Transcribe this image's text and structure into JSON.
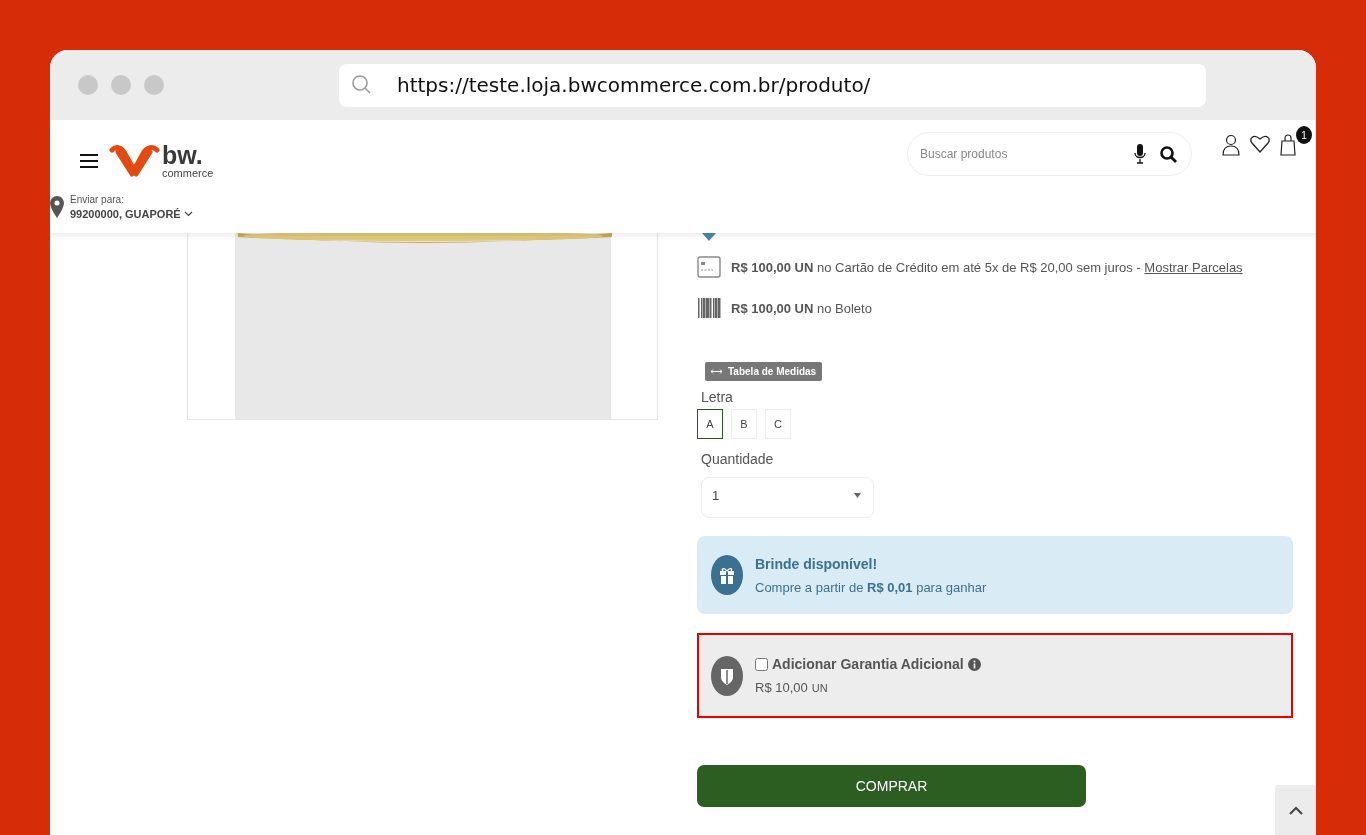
{
  "browser": {
    "url": "https://teste.loja.bwcommerce.com.br/produto/"
  },
  "header": {
    "logo": {
      "name": "bw.",
      "tagline": "commerce"
    },
    "search": {
      "placeholder": "Buscar produtos"
    },
    "cart_count": "1",
    "shipping": {
      "label": "Enviar para:",
      "location": "99200000, GUAPORÉ"
    }
  },
  "payments": [
    {
      "kind": "card",
      "text": "**R$ 100,00 UN** no Cartão de Crédito em até 5x de R$ 20,00 sem juros -",
      "link": "Mostrar Parcelas"
    },
    {
      "kind": "boleto",
      "text": "**R$ 100,00 UN** no Boleto"
    }
  ],
  "size_chart": "Tabela de Medidas",
  "variant": {
    "label": "Letra",
    "options": [
      {
        "label": "A",
        "selected": true
      },
      {
        "label": "B",
        "selected": false
      },
      {
        "label": "C",
        "selected": false
      }
    ]
  },
  "quantity": {
    "label": "Quantidade",
    "value": "1"
  },
  "gift": {
    "title": "Brinde disponível!",
    "text": "Compre a partir de **R$ 0,01** para ganhar"
  },
  "warranty": {
    "label": "Adicionar Garantia Adicional",
    "checked": false,
    "price": "R$ 10,00",
    "unit": "UN"
  },
  "buy_button": "COMPRAR"
}
